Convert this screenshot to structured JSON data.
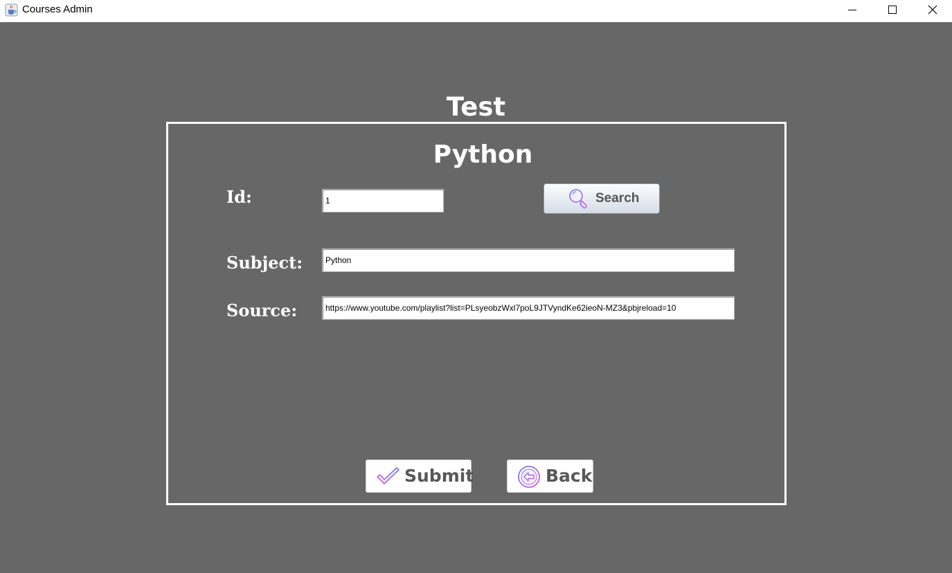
{
  "window": {
    "title": "Courses Admin",
    "icon": "java-cup-icon",
    "controls": [
      "minimize-icon",
      "maximize-icon",
      "close-icon"
    ]
  },
  "header": {
    "title": "Test"
  },
  "form": {
    "subject_title": "Python",
    "id": {
      "label": "Id:",
      "value": "1"
    },
    "search_button": {
      "label": "Search",
      "icon": "magnifier-icon"
    },
    "subject": {
      "label": "Subject:",
      "value": "Python"
    },
    "source": {
      "label": "Source:",
      "value": "https://www.youtube.com/playlist?list=PLsyeobzWxl7poL9JTVyndKe62ieoN-MZ3&pbjreload=10"
    }
  },
  "actions": {
    "submit": {
      "label": "Submit",
      "icon": "checkmark-icon"
    },
    "back": {
      "label": "Back",
      "icon": "back-arrow-icon"
    }
  },
  "colors": {
    "background": "#676767",
    "frame": "#ffffff",
    "button_text": "#585858",
    "icon_gradient": [
      "#6d7cf0",
      "#d15be0"
    ]
  }
}
